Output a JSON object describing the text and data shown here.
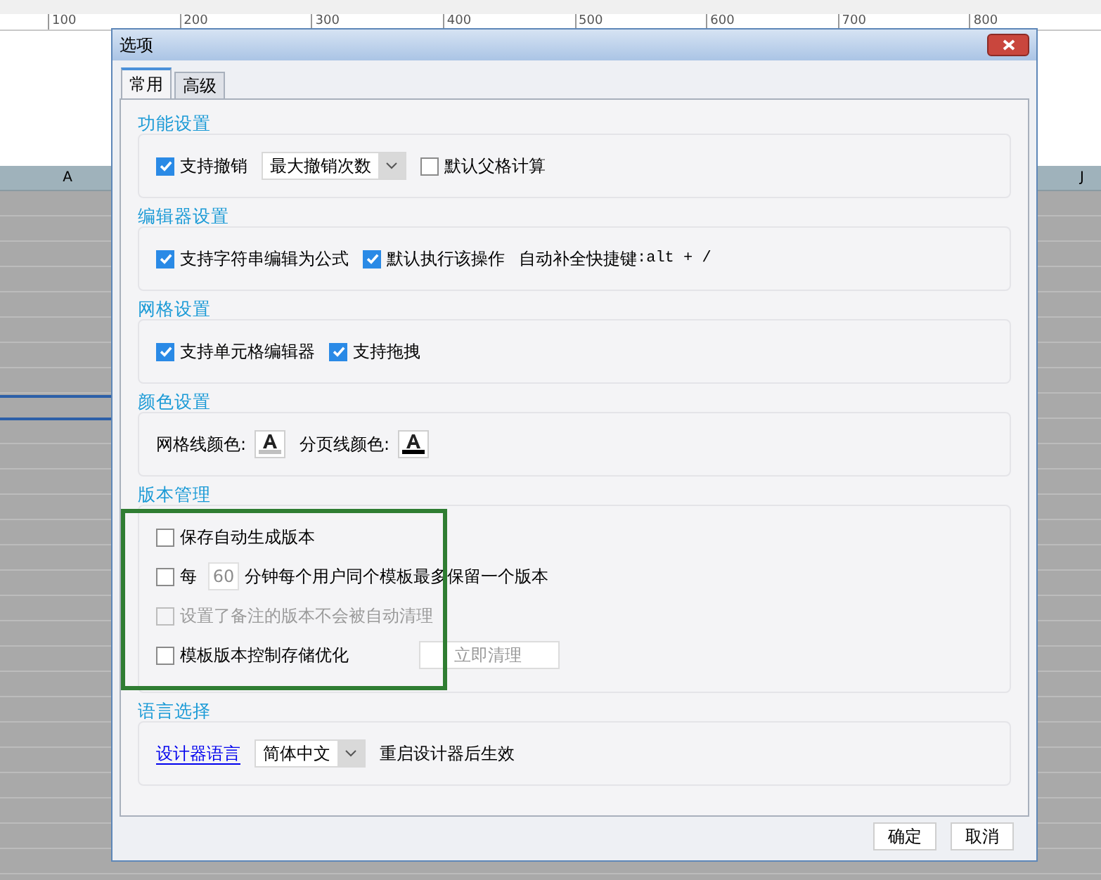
{
  "ruler": {
    "ticks": [
      "100",
      "200",
      "300",
      "400",
      "500",
      "600",
      "700",
      "800"
    ]
  },
  "sheet": {
    "columns": [
      {
        "label": "A"
      },
      {
        "label": "J"
      }
    ]
  },
  "dialog": {
    "title": "选项",
    "tabs": [
      {
        "label": "常用",
        "selected": true
      },
      {
        "label": "高级",
        "selected": false
      }
    ],
    "sections": [
      {
        "title": "功能设置",
        "rows": [
          [
            {
              "kind": "checkbox",
              "label": "支持撤销",
              "checked": true
            },
            {
              "kind": "dropdown",
              "value": "最大撤销次数"
            },
            {
              "kind": "checkbox",
              "label": "默认父格计算",
              "checked": false
            }
          ]
        ]
      },
      {
        "title": "编辑器设置",
        "rows": [
          [
            {
              "kind": "checkbox",
              "label": "支持字符串编辑为公式",
              "checked": true
            },
            {
              "kind": "checkbox",
              "label": "默认执行该操作",
              "checked": true
            },
            {
              "kind": "shortcut",
              "label": "自动补全快捷键",
              "keys": ":alt + /"
            }
          ]
        ]
      },
      {
        "title": "网格设置",
        "rows": [
          [
            {
              "kind": "checkbox",
              "label": "支持单元格编辑器",
              "checked": true
            },
            {
              "kind": "checkbox",
              "label": "支持拖拽",
              "checked": true
            }
          ]
        ]
      },
      {
        "title": "颜色设置",
        "rows": [
          [
            {
              "kind": "color",
              "label": "网格线颜色:",
              "color": "#c0c0c0"
            },
            {
              "kind": "color",
              "label": "分页线颜色:",
              "color": "#000000"
            }
          ]
        ]
      },
      {
        "title": "版本管理",
        "highlighted": true,
        "rows": [
          [
            {
              "kind": "checkbox",
              "label": "保存自动生成版本",
              "checked": false
            }
          ],
          [
            {
              "kind": "interval",
              "checked": false,
              "prefix": "每",
              "placeholder": "60",
              "suffix": "分钟每个用户同个模板最多保留一个版本"
            }
          ],
          [
            {
              "kind": "checkbox",
              "label": "设置了备注的版本不会被自动清理",
              "checked": false,
              "disabled": true
            }
          ],
          [
            {
              "kind": "checkbox_action",
              "label": "模板版本控制存储优化",
              "checked": false,
              "action": "立即清理",
              "action_disabled": true
            }
          ]
        ]
      },
      {
        "title": "语言选择",
        "rows": [
          [
            {
              "kind": "link",
              "label": "设计器语言"
            },
            {
              "kind": "dropdown",
              "value": "简体中文"
            },
            {
              "kind": "text",
              "label": "重启设计器后生效"
            }
          ]
        ]
      }
    ],
    "buttons": [
      "确定",
      "取消"
    ]
  }
}
